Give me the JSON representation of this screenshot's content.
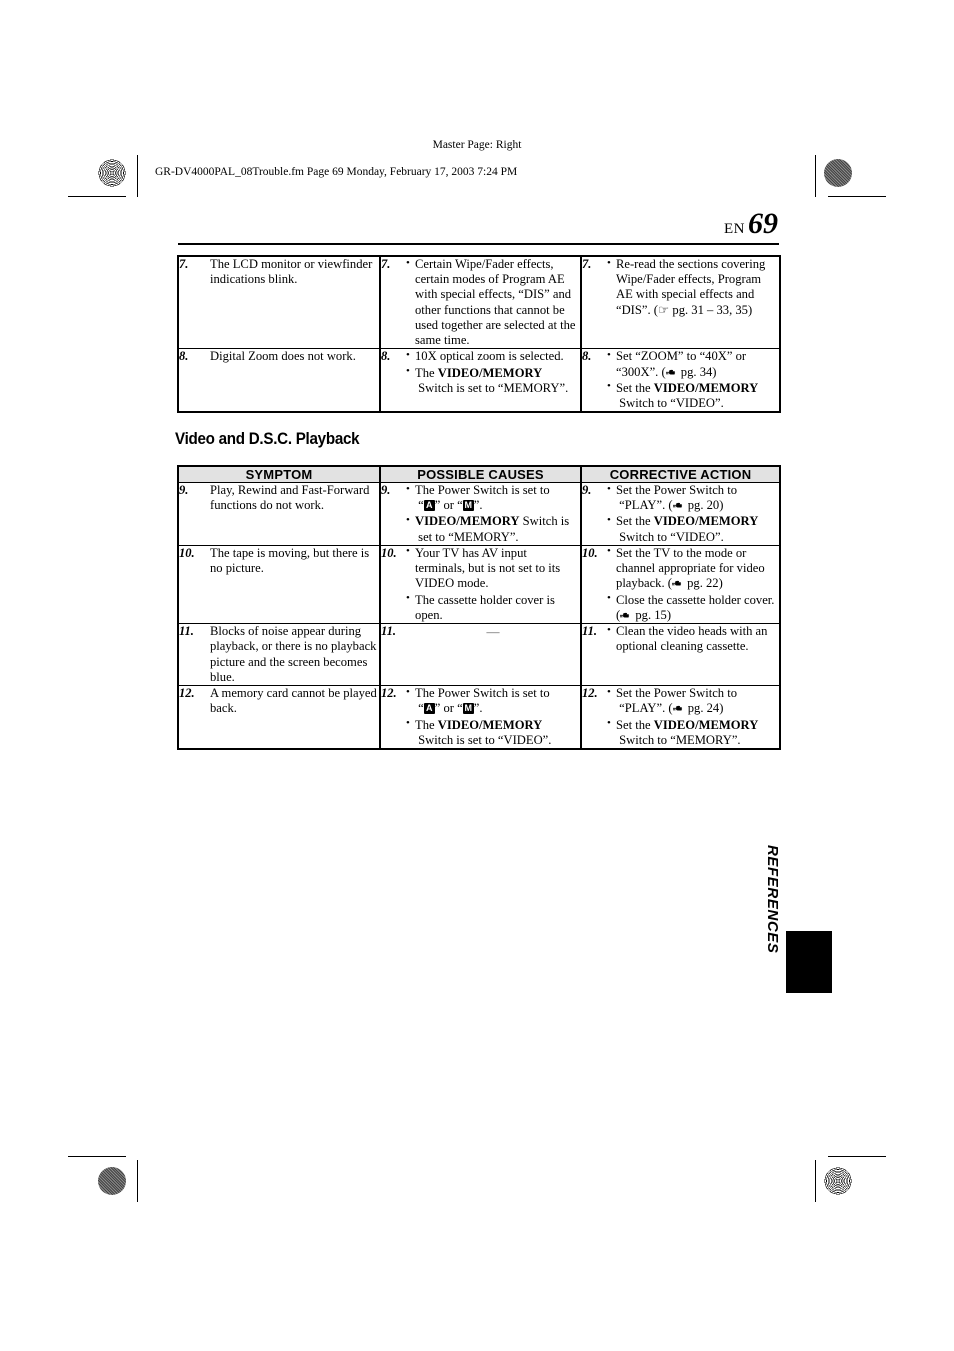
{
  "header": {
    "master_page": "Master Page: Right",
    "filestamp": "GR-DV4000PAL_08Trouble.fm  Page 69  Monday, February 17, 2003  7:24 PM",
    "lang_code": "EN",
    "page_number": "69"
  },
  "section": {
    "title": "Video and D.S.C. Playback"
  },
  "table_headers": {
    "symptom": "SYMPTOM",
    "possible_causes": "POSSIBLE CAUSES",
    "corrective_action": "CORRECTIVE ACTION"
  },
  "table_top": {
    "rows": [
      {
        "num": "7.",
        "symptom": "The LCD monitor or viewfinder indications blink.",
        "causes": [
          "Certain Wipe/Fader effects, certain modes of Program AE with special effects, “DIS” and other functions that cannot be used together are selected at the same time."
        ],
        "actions": [
          "Re-read the sections covering Wipe/Fader effects, Program AE with special effects and “DIS”. (☞ pg. 31 – 33, 35)"
        ]
      },
      {
        "num": "8.",
        "symptom": "Digital Zoom does not work.",
        "causes": [
          "10X optical zoom is selected.",
          "The VIDEO/MEMORY Switch is set to “MEMORY”."
        ],
        "actions": [
          "Set “ZOOM” to “40X” or “300X”. (☞ pg. 34)",
          "Set the VIDEO/MEMORY Switch to “VIDEO”."
        ]
      }
    ]
  },
  "table_main": {
    "rows": [
      {
        "num": "9.",
        "symptom": "Play, Rewind and Fast-Forward functions do not work.",
        "causes_html": [
          "The Power Switch is set to “A” or “M”.",
          "VIDEO/MEMORY Switch is set to “MEMORY”."
        ],
        "actions_html": [
          "Set the Power Switch to “PLAY”. (☞ pg. 20)",
          "Set the VIDEO/MEMORY Switch to “VIDEO”."
        ]
      },
      {
        "num": "10.",
        "symptom": "The tape is moving, but there is no picture.",
        "causes_html": [
          "Your TV has AV input terminals, but is not set to its VIDEO mode.",
          "The cassette holder cover is open."
        ],
        "actions_html": [
          "Set the TV to the mode or channel appropriate for video playback. (☞ pg. 22)",
          "Close the cassette holder cover. (☞ pg. 15)"
        ]
      },
      {
        "num": "11.",
        "symptom": "Blocks of noise appear during playback, or there is no playback picture and the screen becomes blue.",
        "causes_html": [
          "—"
        ],
        "actions_html": [
          "Clean the video heads with an optional cleaning cassette."
        ]
      },
      {
        "num": "12.",
        "symptom": "A memory card cannot be played back.",
        "causes_html": [
          "The Power Switch is set to “A” or “M”.",
          "The VIDEO/MEMORY Switch is set to “VIDEO”."
        ],
        "actions_html": [
          "Set the Power Switch to “PLAY”. (☞ pg. 24)",
          "Set the VIDEO/MEMORY Switch to “MEMORY”."
        ]
      }
    ]
  },
  "side_tab": {
    "label": "REFERENCES"
  },
  "icons": {
    "mode_auto": "A",
    "mode_manual": "M",
    "page_ref": "pointing-hand-icon"
  },
  "colors": {
    "ink": "#000000",
    "header_fill": "#e2e2e2",
    "paper": "#ffffff"
  }
}
